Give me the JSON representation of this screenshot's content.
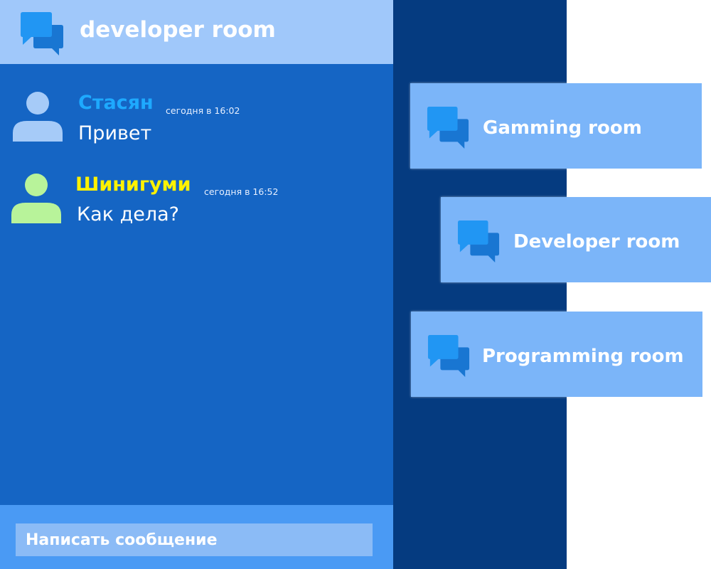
{
  "colors": {
    "header_bg": "#a0c8fa",
    "chat_bg": "#1565c4",
    "divider_bg": "#053b80",
    "card_bg": "#7bb5f9",
    "composer_bg": "#4a9af4",
    "icon_primary": "#2196f3",
    "icon_secondary": "#1976d2"
  },
  "header": {
    "title": "developer room",
    "icon": "chat-bubbles-icon"
  },
  "messages": [
    {
      "author": "Стасян",
      "author_color": "#1ea9ff",
      "avatar_color": "#a6cbf8",
      "avatar_icon": "user-icon",
      "time": "сегодня в 16:02",
      "text": "Привет"
    },
    {
      "author": "Шинигуми",
      "author_color": "#fff200",
      "avatar_color": "#b8f39a",
      "avatar_icon": "user-icon",
      "time": "сегодня в 16:52",
      "text": "Как дела?"
    }
  ],
  "composer": {
    "placeholder": "Написать сообщение"
  },
  "rooms": [
    {
      "label": "Gamming room",
      "icon": "chat-bubbles-icon"
    },
    {
      "label": "Developer room",
      "icon": "chat-bubbles-icon"
    },
    {
      "label": "Programming room",
      "icon": "chat-bubbles-icon"
    }
  ]
}
